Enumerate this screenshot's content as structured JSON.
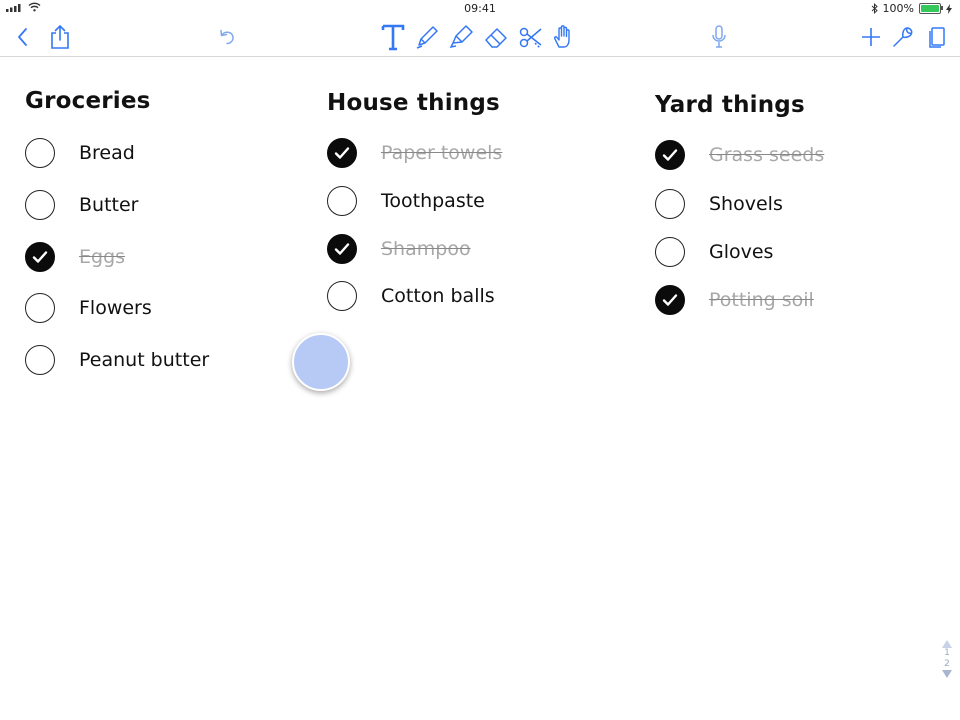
{
  "status_bar": {
    "time": "09:41",
    "battery": "100%",
    "icons": [
      "cellular-signal-icon",
      "wifi-icon",
      "bluetooth-icon",
      "battery-icon",
      "charging-icon"
    ]
  },
  "toolbar": {
    "left": [
      "back-icon",
      "share-icon",
      "undo-icon"
    ],
    "tools": [
      "text-tool-icon",
      "pen-tool-icon",
      "highlighter-tool-icon",
      "eraser-tool-icon",
      "scissors-tool-icon",
      "hand-tool-icon"
    ],
    "active_tool": "text-tool-icon",
    "accent_color": "#3478f6",
    "right": [
      "microphone-icon",
      "add-icon",
      "settings-wrench-icon",
      "pages-icon"
    ]
  },
  "lists": [
    {
      "title": "Groceries",
      "items": [
        {
          "label": "Bread",
          "checked": false
        },
        {
          "label": "Butter",
          "checked": false
        },
        {
          "label": "Eggs",
          "checked": true
        },
        {
          "label": "Flowers",
          "checked": false
        },
        {
          "label": "Peanut butter",
          "checked": false
        }
      ]
    },
    {
      "title": "House things",
      "items": [
        {
          "label": "Paper towels",
          "checked": true
        },
        {
          "label": "Toothpaste",
          "checked": false
        },
        {
          "label": "Shampoo",
          "checked": true
        },
        {
          "label": "Cotton balls",
          "checked": false
        }
      ]
    },
    {
      "title": "Yard things",
      "items": [
        {
          "label": "Grass seeds",
          "checked": true
        },
        {
          "label": "Shovels",
          "checked": false
        },
        {
          "label": "Gloves",
          "checked": false
        },
        {
          "label": "Potting soil",
          "checked": true
        }
      ]
    }
  ],
  "pager": {
    "current": "1",
    "total": "2"
  }
}
